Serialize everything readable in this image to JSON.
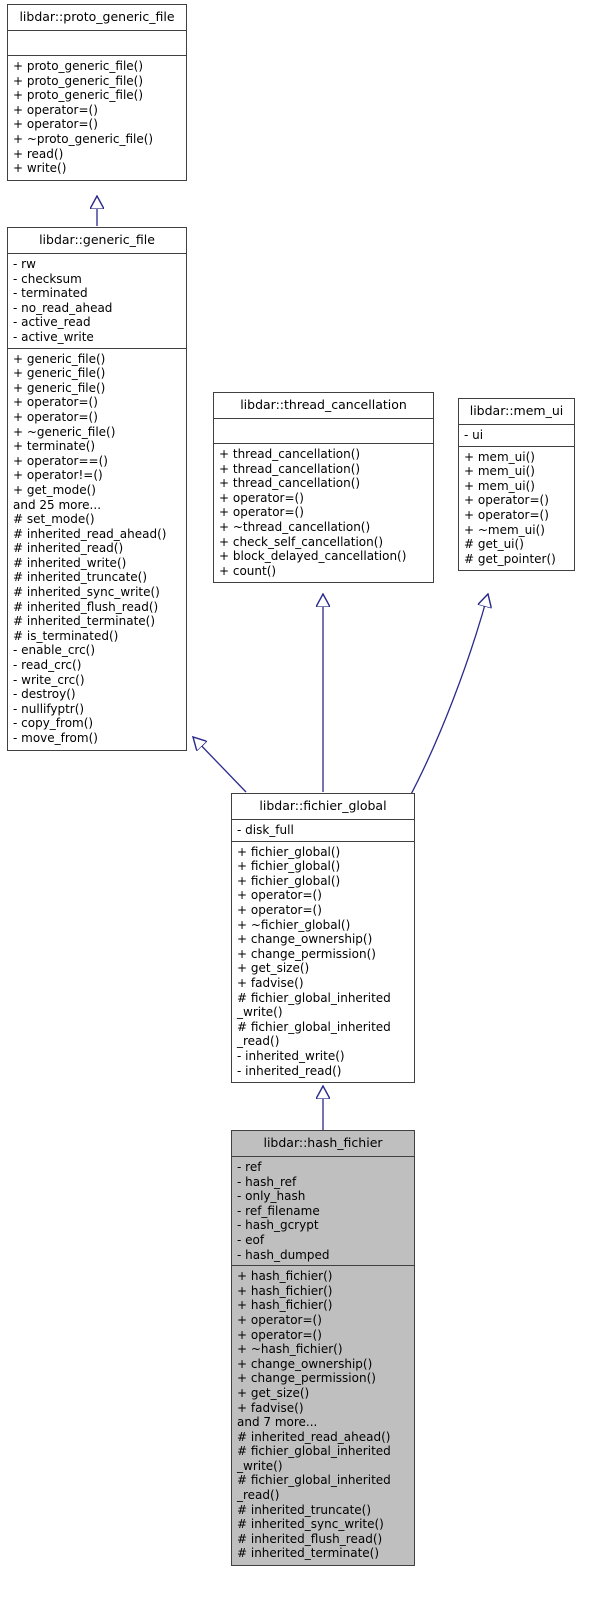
{
  "diagram": {
    "type": "uml-class-inheritance",
    "title": "libdar::hash_fichier inheritance diagram",
    "background_color": "#ffffff",
    "border_color": "#404040",
    "edge_color": "#2a2a8c",
    "highlight_fill": "#bfbfbf",
    "text_color": "#000000"
  },
  "classes": [
    {
      "id": "proto_generic_file",
      "name": "libdar::proto_generic_file",
      "highlighted": false,
      "attributes": [],
      "operations": [
        "+ proto_generic_file()",
        "+ proto_generic_file()",
        "+ proto_generic_file()",
        "+ operator=()",
        "+ operator=()",
        "+ ~proto_generic_file()",
        "+ read()",
        "+ write()"
      ]
    },
    {
      "id": "generic_file",
      "name": "libdar::generic_file",
      "highlighted": false,
      "attributes": [
        "- rw",
        "- checksum",
        "- terminated",
        "- no_read_ahead",
        "- active_read",
        "- active_write"
      ],
      "operations": [
        "+ generic_file()",
        "+ generic_file()",
        "+ generic_file()",
        "+ operator=()",
        "+ operator=()",
        "+ ~generic_file()",
        "+ terminate()",
        "+ operator==()",
        "+ operator!=()",
        "+ get_mode()",
        "and 25 more...",
        "# set_mode()",
        "# inherited_read_ahead()",
        "# inherited_read()",
        "# inherited_write()",
        "# inherited_truncate()",
        "# inherited_sync_write()",
        "# inherited_flush_read()",
        "# inherited_terminate()",
        "# is_terminated()",
        "- enable_crc()",
        "- read_crc()",
        "- write_crc()",
        "- destroy()",
        "- nullifyptr()",
        "- copy_from()",
        "- move_from()"
      ]
    },
    {
      "id": "thread_cancellation",
      "name": "libdar::thread_cancellation",
      "highlighted": false,
      "attributes": [],
      "operations": [
        "+ thread_cancellation()",
        "+ thread_cancellation()",
        "+ thread_cancellation()",
        "+ operator=()",
        "+ operator=()",
        "+ ~thread_cancellation()",
        "+ check_self_cancellation()",
        "+ block_delayed_cancellation()",
        "+ count()"
      ]
    },
    {
      "id": "mem_ui",
      "name": "libdar::mem_ui",
      "highlighted": false,
      "attributes": [
        "- ui"
      ],
      "operations": [
        "+ mem_ui()",
        "+ mem_ui()",
        "+ mem_ui()",
        "+ operator=()",
        "+ operator=()",
        "+ ~mem_ui()",
        "# get_ui()",
        "# get_pointer()"
      ]
    },
    {
      "id": "fichier_global",
      "name": "libdar::fichier_global",
      "highlighted": false,
      "attributes": [
        "- disk_full"
      ],
      "operations": [
        "+ fichier_global()",
        "+ fichier_global()",
        "+ fichier_global()",
        "+ operator=()",
        "+ operator=()",
        "+ ~fichier_global()",
        "+ change_ownership()",
        "+ change_permission()",
        "+ get_size()",
        "+ fadvise()",
        "# fichier_global_inherited",
        "_write()",
        "# fichier_global_inherited",
        "_read()",
        "- inherited_write()",
        "- inherited_read()"
      ]
    },
    {
      "id": "hash_fichier",
      "name": "libdar::hash_fichier",
      "highlighted": true,
      "attributes": [
        "- ref",
        "- hash_ref",
        "- only_hash",
        "- ref_filename",
        "- hash_gcrypt",
        "- eof",
        "- hash_dumped"
      ],
      "operations": [
        "+ hash_fichier()",
        "+ hash_fichier()",
        "+ hash_fichier()",
        "+ operator=()",
        "+ operator=()",
        "+ ~hash_fichier()",
        "+ change_ownership()",
        "+ change_permission()",
        "+ get_size()",
        "+ fadvise()",
        "and 7 more...",
        "# inherited_read_ahead()",
        "# fichier_global_inherited",
        "_write()",
        "# fichier_global_inherited",
        "_read()",
        "# inherited_truncate()",
        "# inherited_sync_write()",
        "# inherited_flush_read()",
        "# inherited_terminate()"
      ]
    }
  ],
  "edges": [
    {
      "id": "edge-generic-file-to-proto",
      "from": "generic_file",
      "to": "proto_generic_file",
      "kind": "inheritance"
    },
    {
      "id": "edge-fichier-global-to-generic-file",
      "from": "fichier_global",
      "to": "generic_file",
      "kind": "inheritance"
    },
    {
      "id": "edge-fichier-global-to-thread-cancellation",
      "from": "fichier_global",
      "to": "thread_cancellation",
      "kind": "inheritance"
    },
    {
      "id": "edge-fichier-global-to-mem-ui",
      "from": "fichier_global",
      "to": "mem_ui",
      "kind": "inheritance"
    },
    {
      "id": "edge-hash-fichier-to-fichier-global",
      "from": "hash_fichier",
      "to": "fichier_global",
      "kind": "inheritance"
    }
  ]
}
